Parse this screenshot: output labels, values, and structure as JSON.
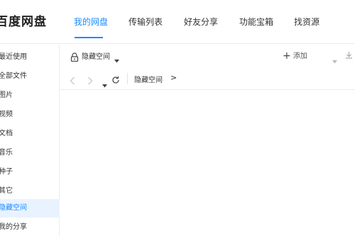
{
  "app": {
    "logo_text": "百度网盘"
  },
  "nav": {
    "tabs": [
      {
        "label": "我的网盘",
        "active": true
      },
      {
        "label": "传输列表",
        "active": false
      },
      {
        "label": "好友分享",
        "active": false
      },
      {
        "label": "功能宝箱",
        "active": false
      },
      {
        "label": "找资源",
        "active": false
      }
    ]
  },
  "sidebar": {
    "items": [
      {
        "label": "最近使用",
        "active": false
      },
      {
        "label": "全部文件",
        "active": false
      },
      {
        "label": "图片",
        "active": false
      },
      {
        "label": "视频",
        "active": false
      },
      {
        "label": "文档",
        "active": false
      },
      {
        "label": "音乐",
        "active": false
      },
      {
        "label": "种子",
        "active": false
      },
      {
        "label": "其它",
        "active": false
      },
      {
        "label": "隐藏空间",
        "active": true
      },
      {
        "label": "我的分享",
        "active": false
      }
    ]
  },
  "toolbar": {
    "title": "隐藏空间",
    "add_label": "添加",
    "download_label": "下载"
  },
  "pathbar": {
    "current": "隐藏空间",
    "arrow": ">"
  },
  "colors": {
    "accent": "#1b8bff",
    "active_bg": "#e8f3ff"
  }
}
